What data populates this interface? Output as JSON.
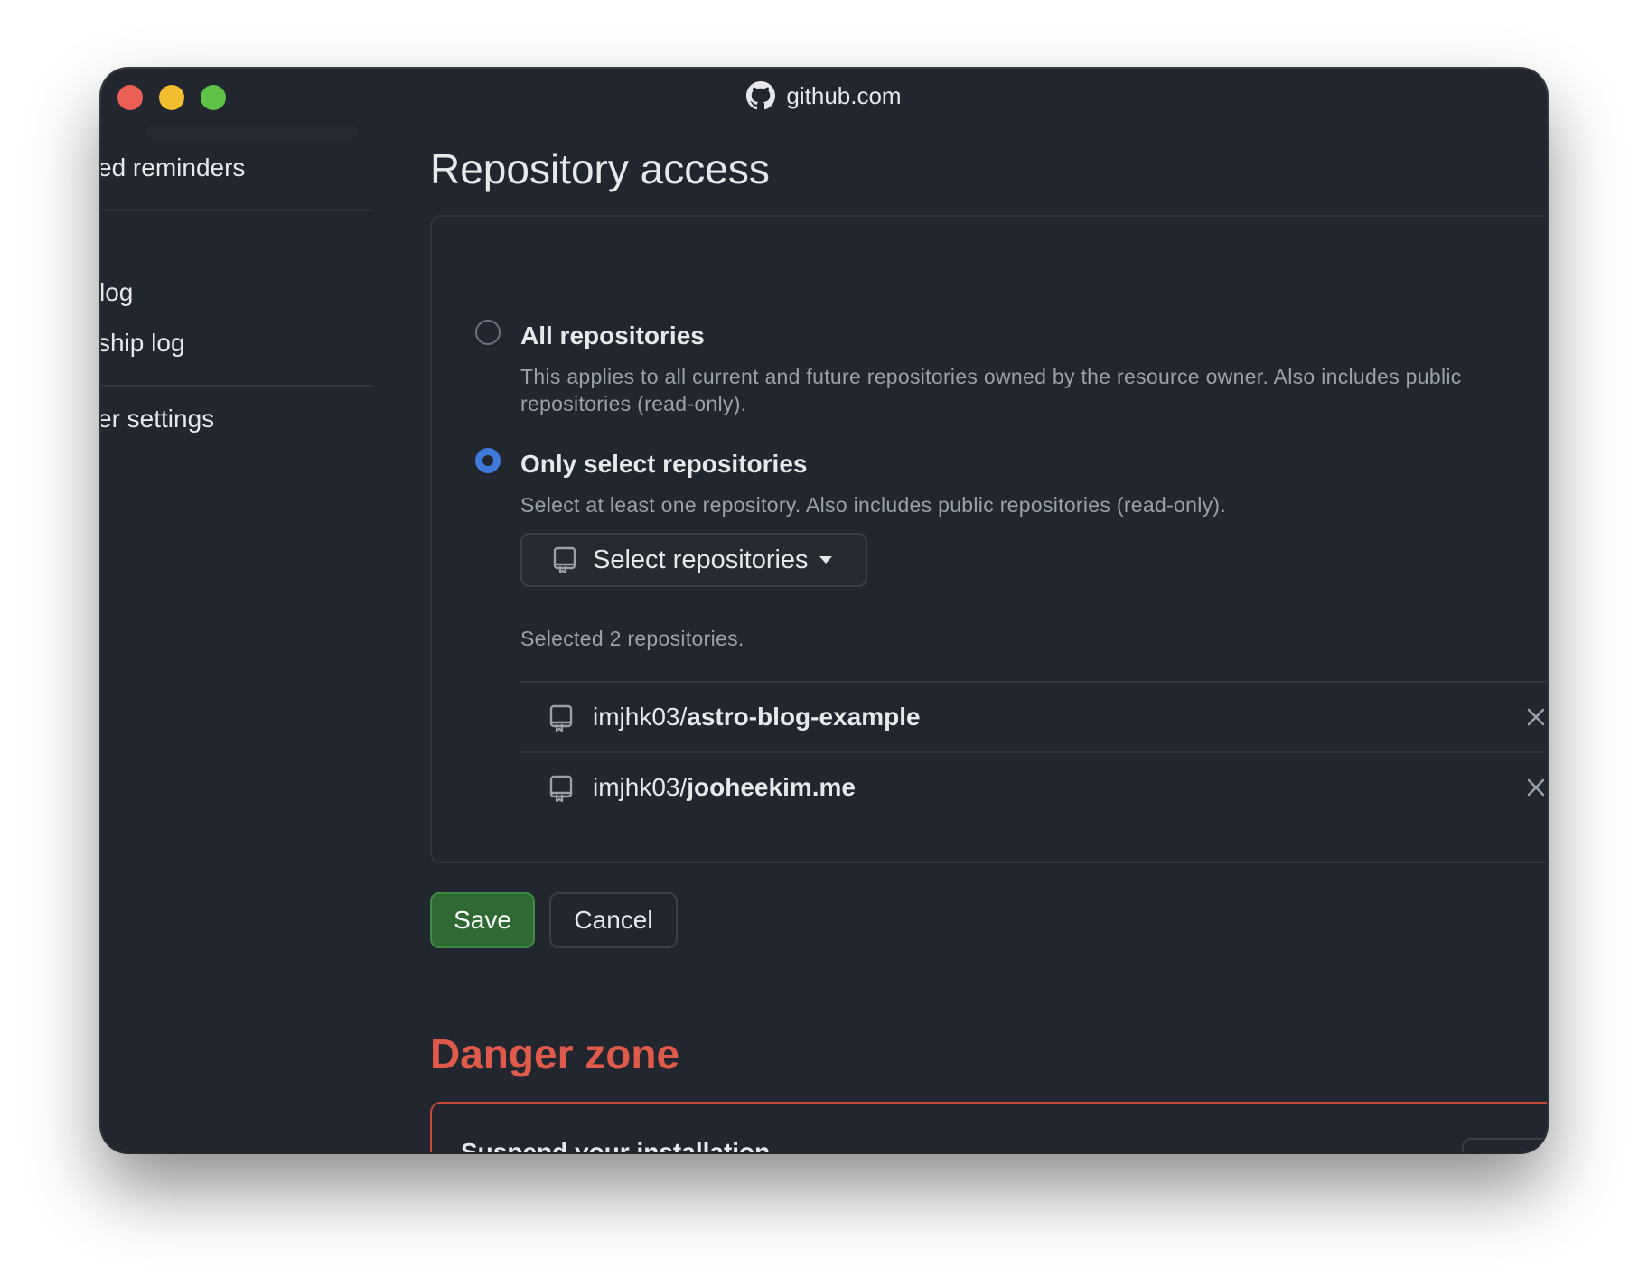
{
  "window": {
    "title": "github.com"
  },
  "sidebar": {
    "items": [
      {
        "label": "ed reminders"
      },
      {
        "label": "log"
      },
      {
        "label": "ship log"
      },
      {
        "label": "er settings"
      }
    ]
  },
  "repository_access": {
    "title": "Repository access",
    "options": [
      {
        "label": "All repositories",
        "description_line1": "This applies to all current and future repositories owned by the resource owner. Also includes public",
        "description_line2": "repositories (read-only).",
        "selected": false
      },
      {
        "label": "Only select repositories",
        "description": "Select at least one repository. Also includes public repositories (read-only).",
        "selected": true
      }
    ],
    "select_button_label": "Select repositories",
    "selected_count_text": "Selected 2 repositories.",
    "repos": [
      {
        "owner": "imjhk03/",
        "name": "astro-blog-example"
      },
      {
        "owner": "imjhk03/",
        "name": "jooheekim.me"
      }
    ]
  },
  "actions": {
    "save_label": "Save",
    "cancel_label": "Cancel"
  },
  "danger_zone": {
    "title": "Danger zone",
    "item_label": "Suspend your installation"
  },
  "colors": {
    "background": "#22262e",
    "accent_radio": "#3f79d9",
    "save_button": "#2f6a35",
    "danger": "#df5a4a"
  },
  "icons": {
    "title": "github-icon",
    "repo": "repo-icon",
    "remove": "x-icon"
  }
}
